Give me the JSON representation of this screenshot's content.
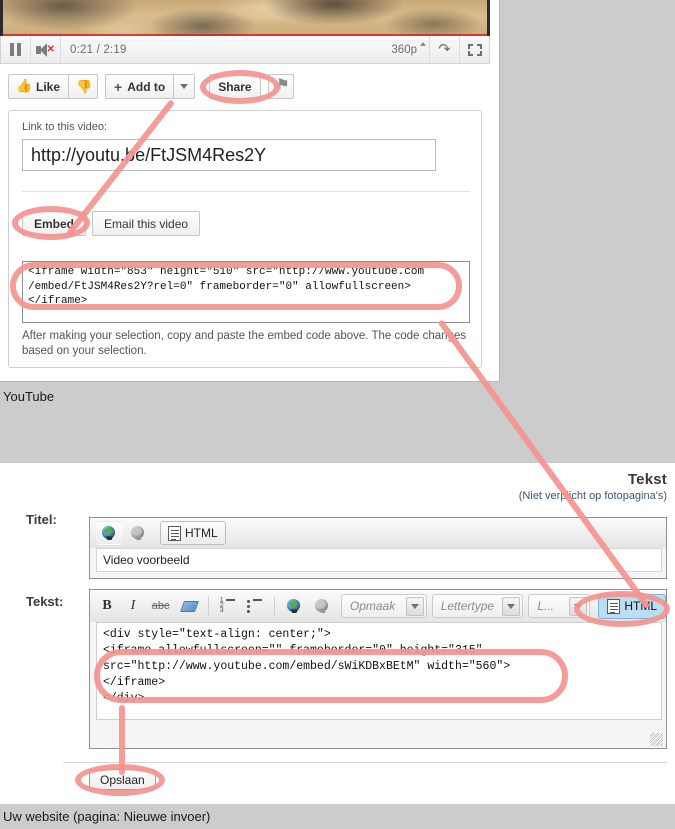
{
  "youtube": {
    "player": {
      "pause_icon": "pause-icon",
      "mute_icon": "volume-muted-icon",
      "time": "0:21 / 2:19",
      "quality": "360p",
      "popout_icon": "popout-icon",
      "fullscreen_icon": "fullscreen-icon"
    },
    "actions": {
      "like_label": "Like",
      "like_icon": "thumbs-up-icon",
      "dislike_icon": "thumbs-down-icon",
      "addto_label": "Add to",
      "addto_plus": "+",
      "share_label": "Share",
      "flag_icon": "flag-icon"
    },
    "share_panel": {
      "link_label": "Link to this video:",
      "link_value": "http://youtu.be/FtJSM4Res2Y",
      "tab_embed": "Embed",
      "tab_email": "Email this video",
      "embed_code": "<iframe width=\"853\" height=\"510\" src=\"http://www.youtube.com\n/embed/FtJSM4Res2Y?rel=0\" frameborder=\"0\" allowfullscreen>\n</iframe>",
      "help_text": "After making your selection, copy and paste the embed code above. The code changes based on your selection."
    },
    "caption": "YouTube"
  },
  "cms": {
    "heading": "Tekst",
    "subheading": "(Niet verplicht op fotopagina's)",
    "titel": {
      "label": "Titel:",
      "value": "Video voorbeeld",
      "toolbar": {
        "link_icon": "insert-link-globe-icon",
        "unlink_icon": "remove-link-globe-icon",
        "html_label": "HTML",
        "html_icon": "source-document-icon"
      }
    },
    "tekst": {
      "label": "Tekst:",
      "toolbar": {
        "bold_label": "B",
        "italic_label": "I",
        "strike_label": "abc",
        "eraser_icon": "remove-format-eraser-icon",
        "ordered_list_icon": "ordered-list-icon",
        "unordered_list_icon": "unordered-list-icon",
        "link_icon": "insert-link-globe-icon",
        "unlink_icon": "remove-link-globe-icon",
        "format_select": "Opmaak",
        "font_select": "Lettertype",
        "size_select": "L...",
        "html_label": "HTML",
        "html_icon": "source-document-icon"
      },
      "code": "<div style=\"text-align: center;\">\n<iframe allowfullscreen=\"\" frameborder=\"0\" height=\"315\"\nsrc=\"http://www.youtube.com/embed/sWiKDBxBEtM\" width=\"560\">\n</iframe>\n</div>"
    },
    "save_label": "Opslaan",
    "footer": "Uw website (pagina: Nieuwe invoer)"
  },
  "annotation_color": "#f4948f"
}
